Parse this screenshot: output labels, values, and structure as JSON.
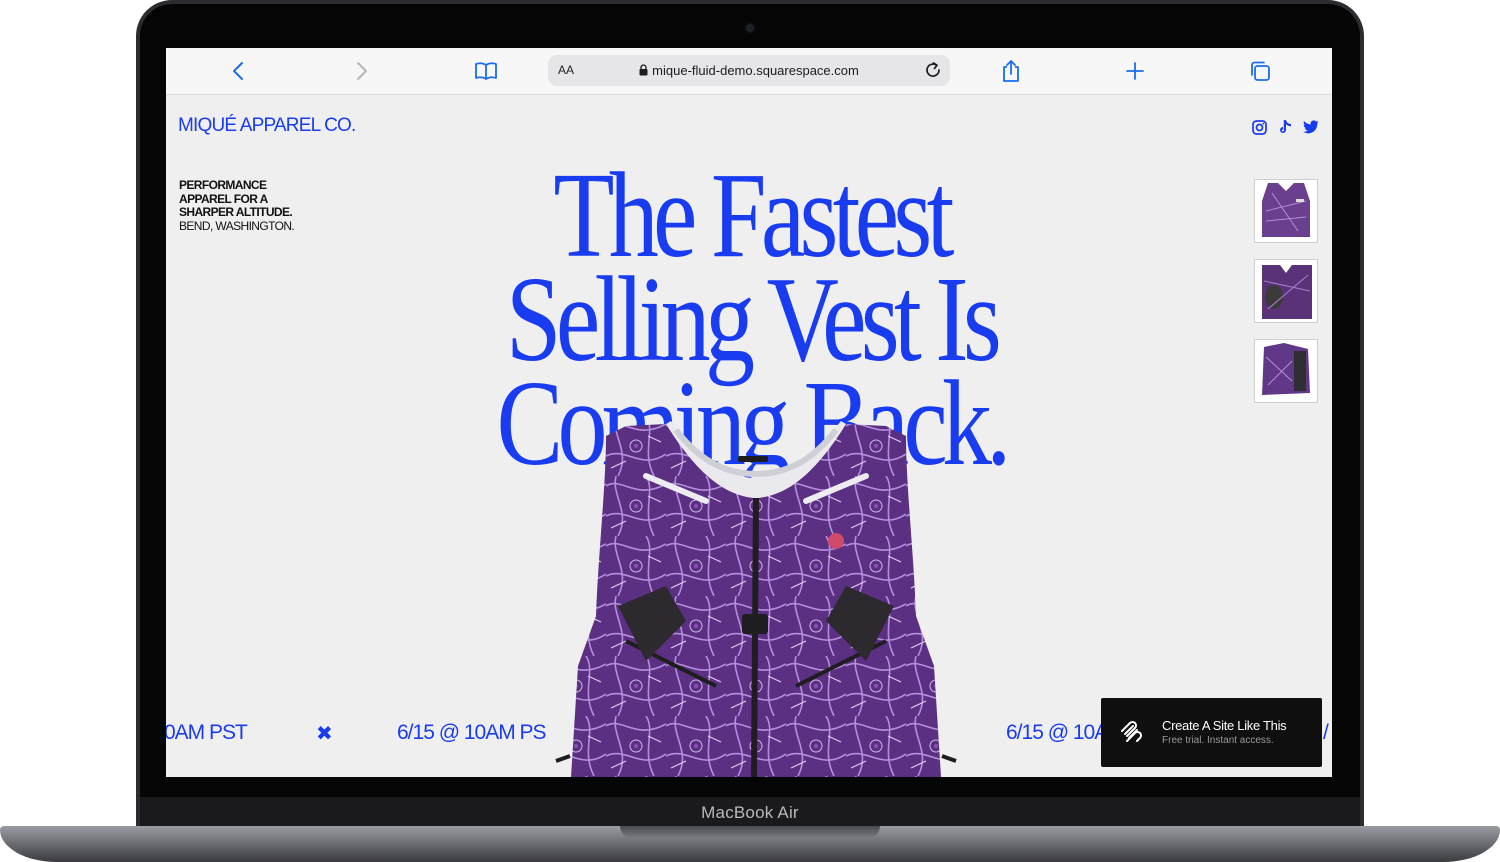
{
  "device": {
    "brand_label": "MacBook Air"
  },
  "browser": {
    "text_size_label": "AA",
    "url": "mique-fluid-demo.squarespace.com",
    "accent": "#1a6cf0",
    "icons": [
      "chevron-left-icon",
      "chevron-right-icon",
      "book-icon",
      "lock-icon",
      "reload-icon",
      "share-icon",
      "plus-icon",
      "tabs-icon"
    ]
  },
  "site": {
    "logo": "MIQUÉ APPAREL CO.",
    "brand_color": "#1a3cf0",
    "social_icons": [
      "instagram-icon",
      "tiktok-icon",
      "twitter-icon"
    ],
    "tagline": {
      "line1": "PERFORMANCE",
      "line2": "APPAREL FOR A",
      "line3": "SHARPER ALTITUDE.",
      "line4": "BEND, WASHINGTON."
    },
    "headline": {
      "line1": "The Fastest",
      "line2": "Selling Vest Is",
      "line3": "Coming Back."
    },
    "ticker": {
      "item1": "0AM PST",
      "separator": "✖",
      "item2": "6/15 @ 10AM PS",
      "item3": "6/15 @ 10A",
      "item4": "/"
    }
  },
  "promo": {
    "title": "Create A Site Like This",
    "subtitle": "Free trial. Instant access."
  }
}
